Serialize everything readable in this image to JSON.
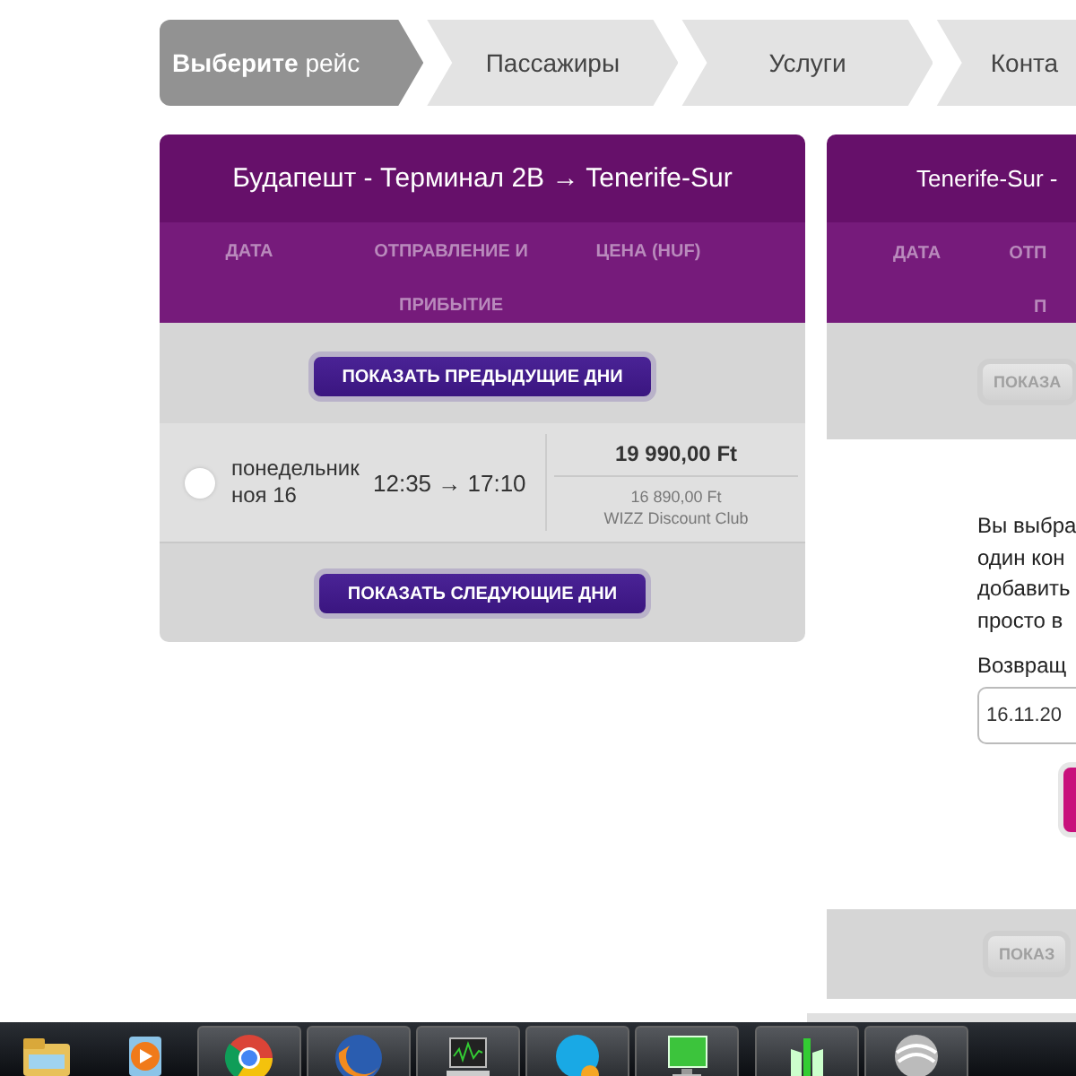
{
  "steps": [
    {
      "label": "**Выберите** рейс",
      "selected": true
    },
    {
      "label": "Пассажиры",
      "selected": false
    },
    {
      "label": "Услуги",
      "selected": false
    },
    {
      "label": "Конта",
      "selected": false
    }
  ],
  "outbound": {
    "title": "Будапешт - Терминал 2B → Tenerife-Sur",
    "columns": [
      "ДАТА",
      "ОТПРАВЛЕНИЕ И ПРИБЫТИЕ",
      "ЦЕНА (HUF)"
    ],
    "prev_button": {
      "label": "ПОКАЗАТЬ ПРЕДЫДУЩИЕ ДНИ",
      "disabled": false
    },
    "flights": [
      {
        "date": "понедельник ноя 16",
        "times": "12:35 → 17:10",
        "price": "19 990,00 Ft",
        "club_price": "16 890,00 Ft",
        "club_label": "WIZZ Discount Club",
        "selected": false
      }
    ],
    "next_button": {
      "label": "ПОКАЗАТЬ СЛЕДУЮЩИЕ ДНИ",
      "disabled": false
    }
  },
  "return": {
    "title": "Tenerife-Sur -",
    "columns": [
      "ДАТА",
      "ОТП\nП"
    ],
    "prev_button": {
      "label": "ПОКАЗА",
      "disabled": true
    },
    "message": "Вы выбра\nодин кон\nдобавить\nпросто в",
    "return_label": "Возвращ",
    "date_field": {
      "value": "16.11.20"
    },
    "next_button": {
      "label": "ПОКАЗ",
      "disabled": true
    }
  }
}
